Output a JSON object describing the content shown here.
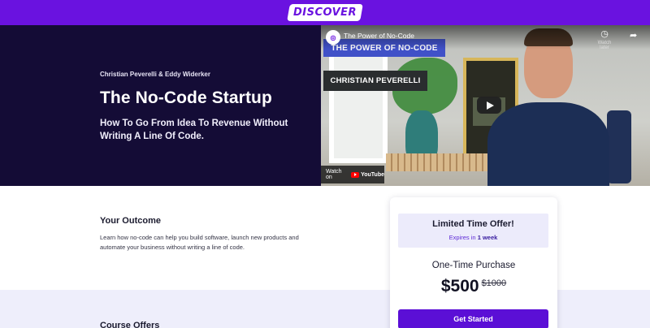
{
  "brand": {
    "logo_text": "DISCOVER",
    "accent": "#6a12e0"
  },
  "hero": {
    "authors": "Christian Peverelli & Eddy Widerker",
    "title": "The No-Code Startup",
    "subtitle": "How To Go From Idea To Revenue Without Writing A Line Of Code.",
    "background": "#140c36"
  },
  "video": {
    "title": "The Power of No-Code",
    "watch_later_label": "Watch later",
    "banner_top": "THE POWER OF NO-CODE",
    "banner_name": "CHRISTIAN PEVERELLI",
    "watch_on_label": "Watch on",
    "youtube_word": "YouTube",
    "icons": {
      "channel": "channel-avatar-icon",
      "watch_later": "clock-icon",
      "share": "share-arrow-icon",
      "play": "play-icon"
    }
  },
  "outcome": {
    "heading": "Your Outcome",
    "body": "Learn how no-code can help you build software, launch new products and automate your business without writing a line of code."
  },
  "course_offers": {
    "heading": "Course Offers"
  },
  "offer": {
    "title": "Limited Time Offer!",
    "expires_prefix": "Expires in",
    "expires_value": "1 week",
    "purchase_label": "One-Time Purchase",
    "price": "$500",
    "old_price": "$1000",
    "cta_label": "Get Started",
    "cta_color": "#5b0fd6"
  }
}
